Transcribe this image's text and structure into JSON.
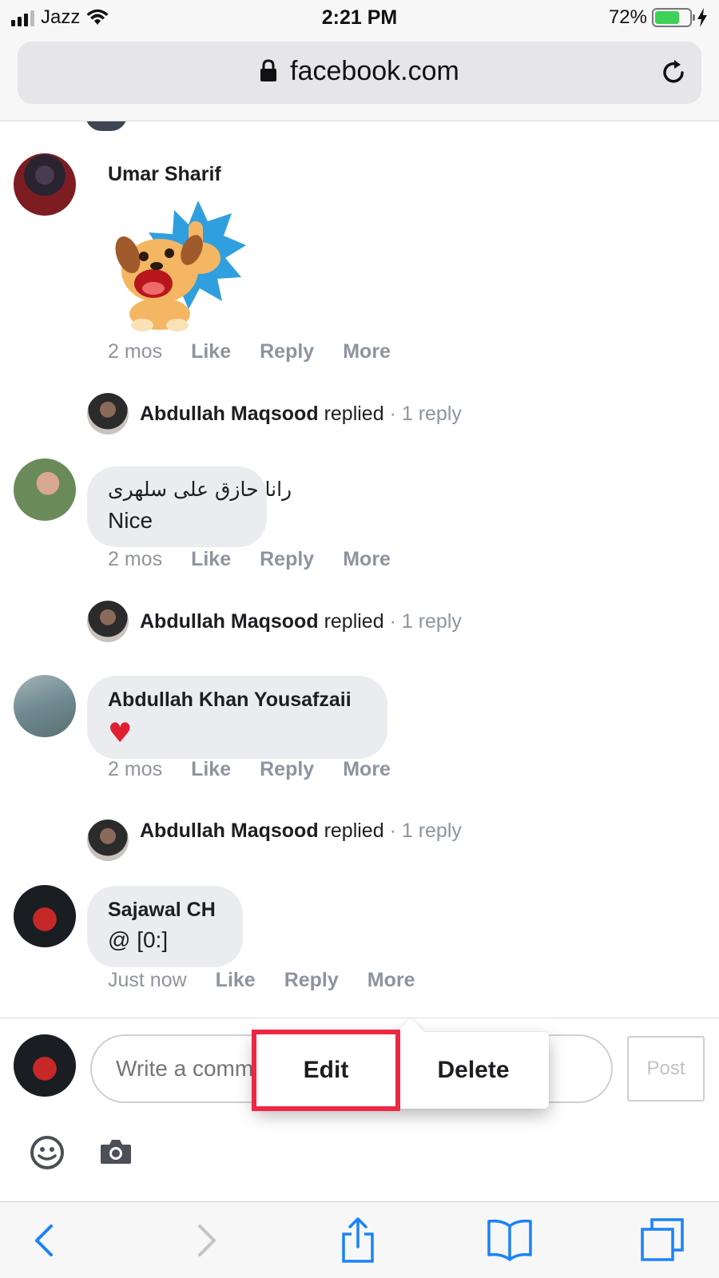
{
  "status_bar": {
    "carrier": "Jazz",
    "time": "2:21 PM",
    "battery_percent": "72%",
    "battery_level": 0.72
  },
  "browser": {
    "url": "facebook.com"
  },
  "comments": [
    {
      "author": "Umar Sharif",
      "content_type": "sticker",
      "timestamp": "2 mos",
      "actions": [
        "Like",
        "Reply",
        "More"
      ],
      "reply_summary": {
        "author": "Abdullah Maqsood",
        "verb": "replied",
        "count": "· 1 reply"
      }
    },
    {
      "author": "رانا حازق علی سلھری",
      "text": "Nice",
      "timestamp": "2 mos",
      "actions": [
        "Like",
        "Reply",
        "More"
      ],
      "reply_summary": {
        "author": "Abdullah Maqsood",
        "verb": "replied",
        "count": "· 1 reply"
      }
    },
    {
      "author": "Abdullah Khan Yousafzaii",
      "text": "♥",
      "timestamp": "2 mos",
      "actions": [
        "Like",
        "Reply",
        "More"
      ],
      "reply_summary": {
        "author": "Abdullah Maqsood",
        "verb": "replied",
        "count": "· 1 reply"
      }
    },
    {
      "author": "Sajawal CH",
      "text": "@ [0:]",
      "timestamp": "Just now",
      "actions": [
        "Like",
        "Reply",
        "More"
      ]
    }
  ],
  "composer": {
    "placeholder": "Write a comment...",
    "post_label": "Post",
    "icons": [
      "emoji-icon",
      "camera-icon"
    ]
  },
  "popup_menu": {
    "items": [
      "Edit",
      "Delete"
    ],
    "highlight_color": "#ee2745"
  },
  "toolbar": {
    "icons": [
      "back-icon",
      "forward-icon",
      "share-icon",
      "bookmarks-icon",
      "tabs-icon"
    ]
  },
  "colors": {
    "accent_blue": "#1a82fb",
    "heart_red": "#e02030",
    "bubble_gray": "#ebecf0",
    "meta_gray": "#8d949e"
  }
}
